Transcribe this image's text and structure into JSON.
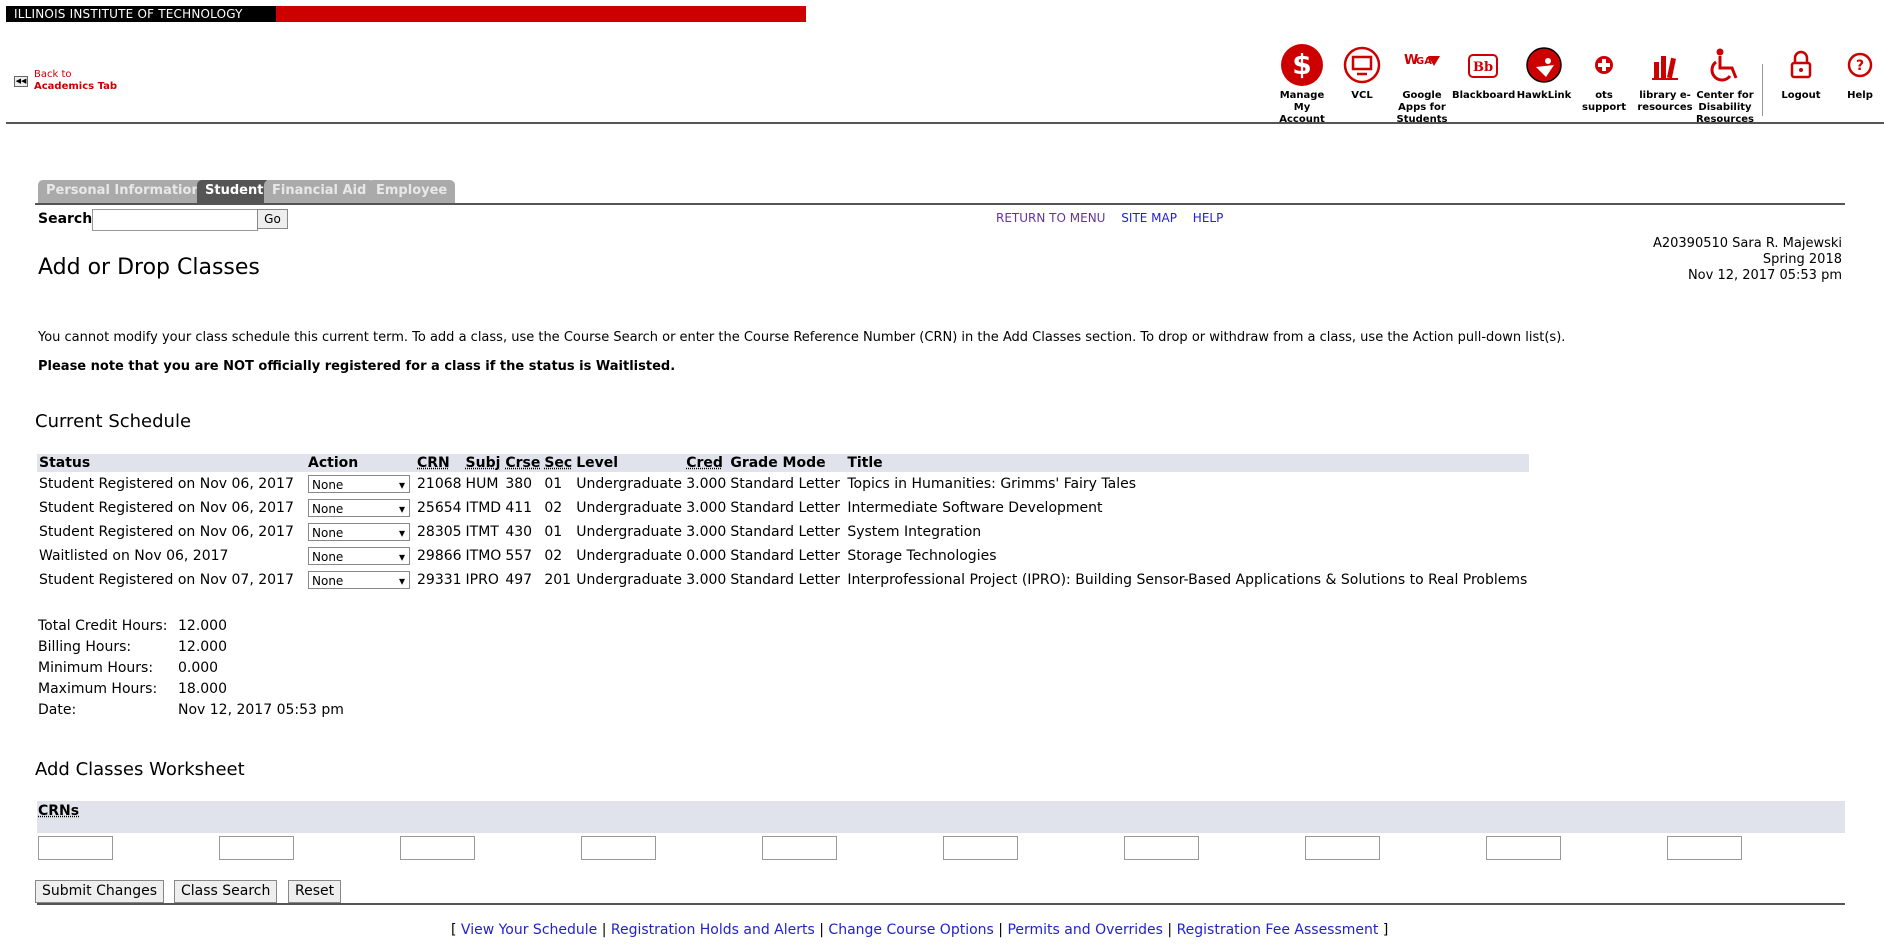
{
  "header": {
    "institution": "ILLINOIS INSTITUTE OF TECHNOLOGY",
    "back_line1": "Back to",
    "back_line2": "Academics Tab",
    "icons": [
      {
        "name": "manage-account",
        "label": "Manage My Account"
      },
      {
        "name": "vcl",
        "label": "VCL"
      },
      {
        "name": "google-apps",
        "label": "Google Apps for Students"
      },
      {
        "name": "blackboard",
        "label": "Blackboard"
      },
      {
        "name": "hawklink",
        "label": "HawkLink"
      },
      {
        "name": "ots-support",
        "label": "ots support"
      },
      {
        "name": "library",
        "label": "library e-resources"
      },
      {
        "name": "disability",
        "label": "Center for Disability Resources"
      },
      {
        "name": "logout",
        "label": "Logout"
      },
      {
        "name": "help",
        "label": "Help"
      }
    ],
    "accent_color": "#cc0000"
  },
  "tabs": [
    "Personal Information",
    "Student",
    "Financial Aid",
    "Employee"
  ],
  "active_tab": "Student",
  "search": {
    "label": "Search",
    "value": "",
    "go_label": "Go"
  },
  "top_links": [
    "RETURN TO MENU",
    "SITE MAP",
    "HELP"
  ],
  "user": {
    "id_name": "A20390510 Sara R. Majewski",
    "term": "Spring 2018",
    "datetime": "Nov 12, 2017 05:53 pm"
  },
  "page_title": "Add or Drop Classes",
  "info_text": "You cannot modify your class schedule this current term. To add a class, use the Course Search or enter the Course Reference Number (CRN) in the Add Classes section. To drop or withdraw from a class, use the Action pull-down list(s).",
  "note_text": "Please note that you are NOT officially registered for a class if the status is Waitlisted.",
  "current_schedule": {
    "heading": "Current Schedule",
    "columns": [
      "Status",
      "Action",
      "CRN",
      "Subj",
      "Crse",
      "Sec",
      "Level",
      "Cred",
      "Grade Mode",
      "Title"
    ],
    "rows": [
      {
        "status": "Student Registered on Nov 06, 2017",
        "action": "None",
        "crn": "21068",
        "subj": "HUM",
        "crse": "380",
        "sec": "01",
        "level": "Undergraduate",
        "cred": "3.000",
        "grade_mode": "Standard Letter",
        "title": "Topics in Humanities: Grimms' Fairy Tales"
      },
      {
        "status": "Student Registered on Nov 06, 2017",
        "action": "None",
        "crn": "25654",
        "subj": "ITMD",
        "crse": "411",
        "sec": "02",
        "level": "Undergraduate",
        "cred": "3.000",
        "grade_mode": "Standard Letter",
        "title": "Intermediate Software Development"
      },
      {
        "status": "Student Registered on Nov 06, 2017",
        "action": "None",
        "crn": "28305",
        "subj": "ITMT",
        "crse": "430",
        "sec": "01",
        "level": "Undergraduate",
        "cred": "3.000",
        "grade_mode": "Standard Letter",
        "title": "System Integration"
      },
      {
        "status": "Waitlisted on Nov 06, 2017",
        "action": "None",
        "crn": "29866",
        "subj": "ITMO",
        "crse": "557",
        "sec": "02",
        "level": "Undergraduate",
        "cred": "0.000",
        "grade_mode": "Standard Letter",
        "title": "Storage Technologies"
      },
      {
        "status": "Student Registered on Nov 07, 2017",
        "action": "None",
        "crn": "29331",
        "subj": "IPRO",
        "crse": "497",
        "sec": "201",
        "level": "Undergraduate",
        "cred": "3.000",
        "grade_mode": "Standard Letter",
        "title": "Interprofessional Project (IPRO): Building Sensor-Based Applications & Solutions to Real Problems"
      }
    ]
  },
  "totals": [
    {
      "label": "Total Credit Hours:",
      "value": "12.000"
    },
    {
      "label": "Billing Hours:",
      "value": "12.000"
    },
    {
      "label": "Minimum Hours:",
      "value": "0.000"
    },
    {
      "label": "Maximum Hours:",
      "value": "18.000"
    },
    {
      "label": "Date:",
      "value": "Nov 12, 2017 05:53 pm"
    }
  ],
  "add_worksheet": {
    "heading": "Add Classes Worksheet",
    "crns_label": "CRNs",
    "crn_values": [
      "",
      "",
      "",
      "",
      "",
      "",
      "",
      "",
      "",
      ""
    ]
  },
  "buttons": {
    "submit": "Submit Changes",
    "class_search": "Class Search",
    "reset": "Reset"
  },
  "bottom_links": [
    "View Your Schedule",
    "Registration Holds and Alerts",
    "Change Course Options",
    "Permits and Overrides",
    "Registration Fee Assessment"
  ]
}
